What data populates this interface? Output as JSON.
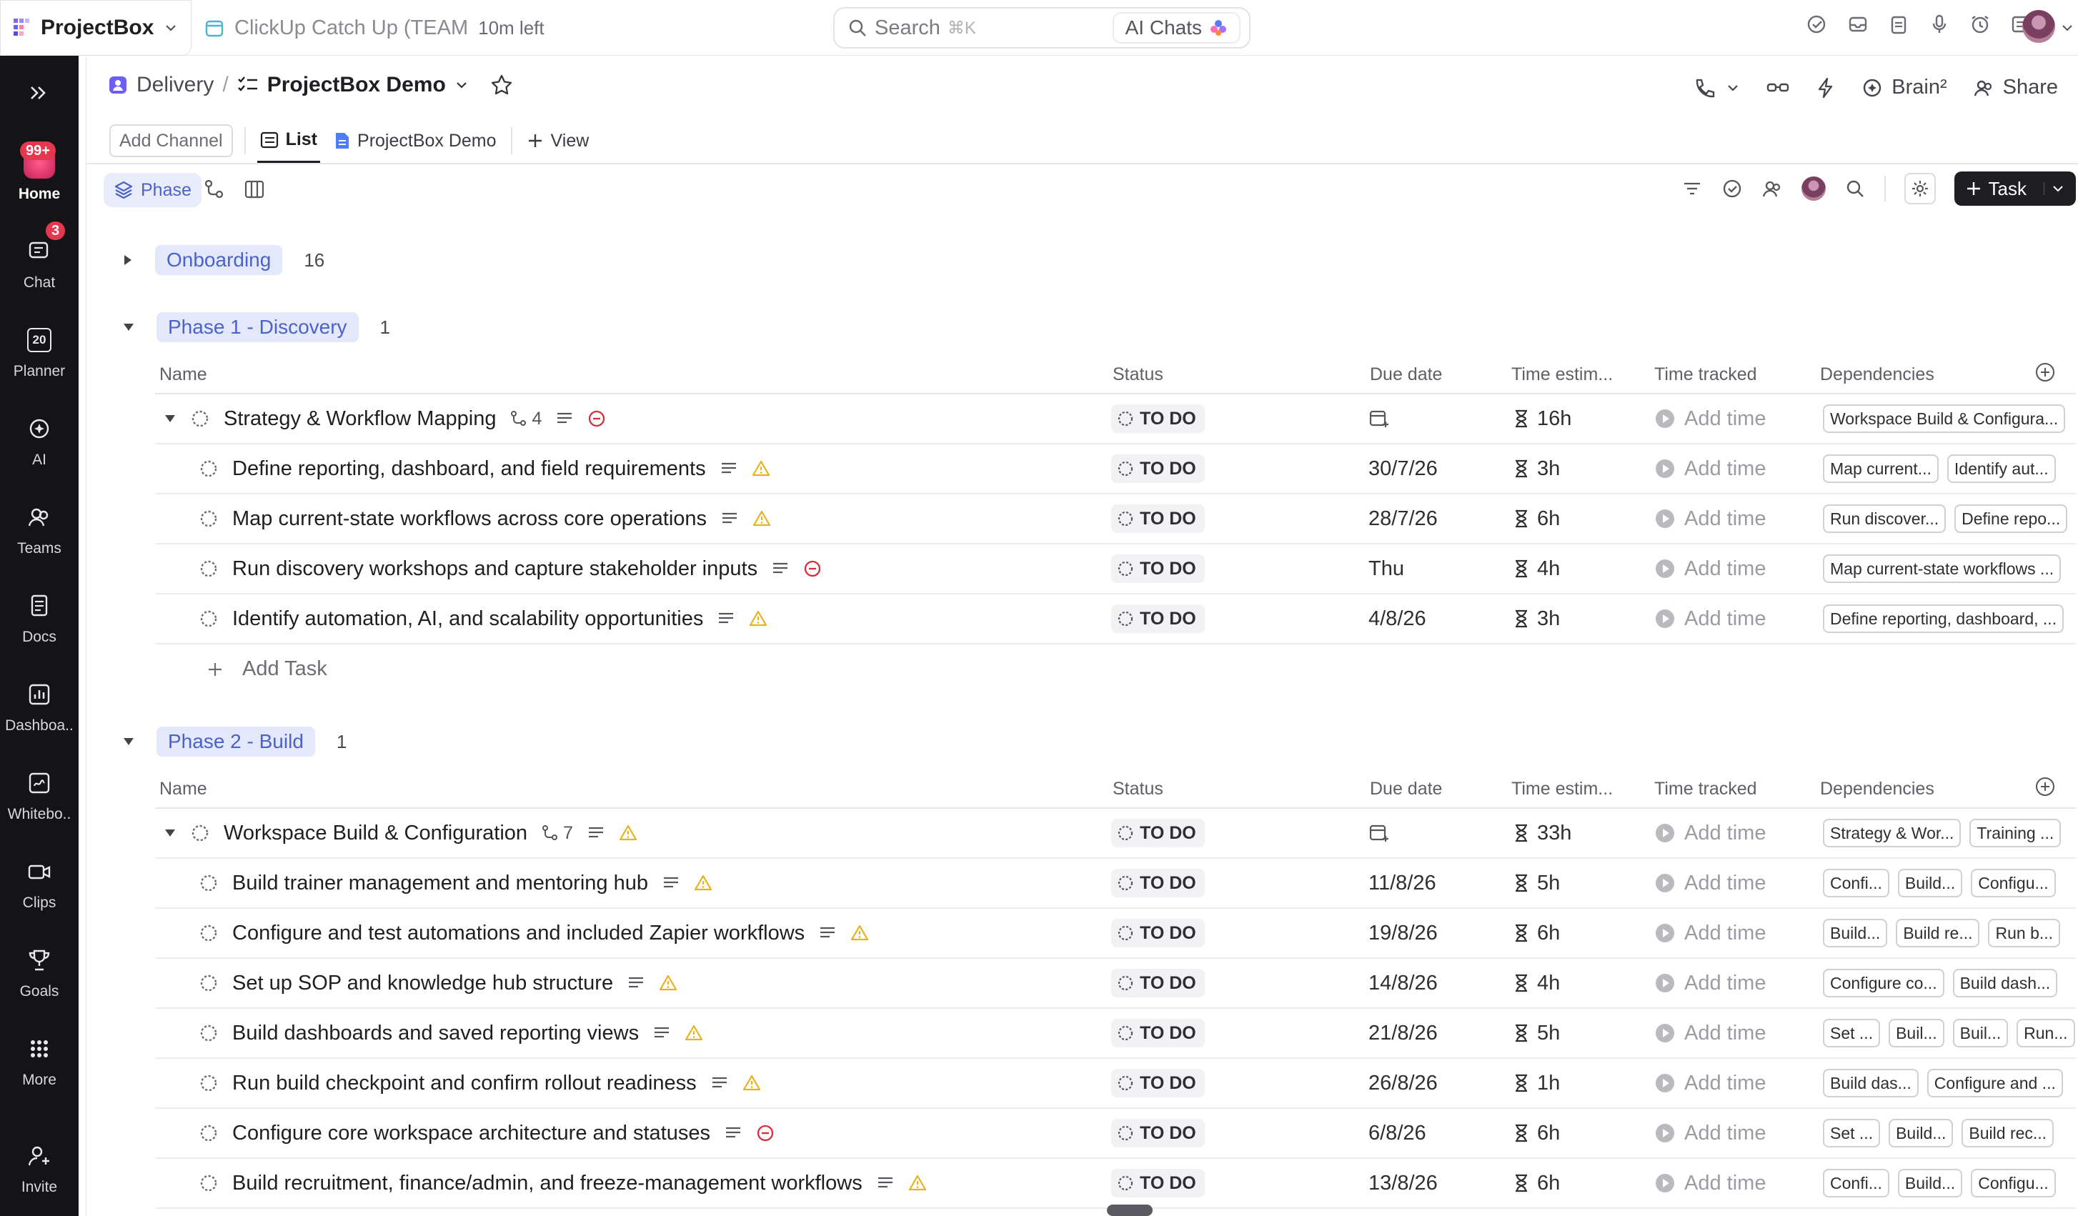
{
  "topbar": {
    "workspace": "ProjectBox",
    "reminder_title": "ClickUp Catch Up (TEAM",
    "reminder_time": "10m left",
    "search_placeholder": "Search",
    "search_shortcut": "⌘K",
    "ai_chats": "AI Chats"
  },
  "sidebar": {
    "items": [
      {
        "label": "Home",
        "badge": "99+"
      },
      {
        "label": "Chat",
        "badge": "3"
      },
      {
        "label": "Planner",
        "badge": "20"
      },
      {
        "label": "AI"
      },
      {
        "label": "Teams"
      },
      {
        "label": "Docs"
      },
      {
        "label": "Dashboa.."
      },
      {
        "label": "Whitebo.."
      },
      {
        "label": "Clips"
      },
      {
        "label": "Goals"
      },
      {
        "label": "More"
      },
      {
        "label": "Invite"
      }
    ]
  },
  "header": {
    "breadcrumb_space": "Delivery",
    "breadcrumb_sep": "/",
    "breadcrumb_list": "ProjectBox Demo",
    "brain": "Brain²",
    "share": "Share"
  },
  "tabs": {
    "add_channel": "Add Channel",
    "list": "List",
    "doc": "ProjectBox Demo",
    "view": "View"
  },
  "filters": {
    "group_by": "Phase",
    "task_button": "Task"
  },
  "columns": {
    "name": "Name",
    "status": "Status",
    "due": "Due date",
    "estimate": "Time estim...",
    "tracked": "Time tracked",
    "deps": "Dependencies"
  },
  "groups": [
    {
      "name": "Onboarding",
      "count": "16",
      "collapsed": true
    },
    {
      "name": "Phase 1 - Discovery",
      "count": "1",
      "parent": {
        "name": "Strategy & Workflow Mapping",
        "subtasks": "4",
        "status": "TO DO",
        "estimate": "16h",
        "tracked": "Add time",
        "deps": [
          "Workspace Build & Configura..."
        ]
      },
      "tasks": [
        {
          "name": "Define reporting, dashboard, and field requirements",
          "flag": "warning",
          "status": "TO DO",
          "due": "30/7/26",
          "estimate": "3h",
          "tracked": "Add time",
          "deps": [
            "Map current...",
            "Identify aut..."
          ]
        },
        {
          "name": "Map current-state workflows across core operations",
          "flag": "warning",
          "status": "TO DO",
          "due": "28/7/26",
          "estimate": "6h",
          "tracked": "Add time",
          "deps": [
            "Run discover...",
            "Define repo..."
          ]
        },
        {
          "name": "Run discovery workshops and capture stakeholder inputs",
          "flag": "blocked",
          "status": "TO DO",
          "due": "Thu",
          "estimate": "4h",
          "tracked": "Add time",
          "deps": [
            "Map current-state workflows ..."
          ]
        },
        {
          "name": "Identify automation, AI, and scalability opportunities",
          "flag": "warning",
          "status": "TO DO",
          "due": "4/8/26",
          "estimate": "3h",
          "tracked": "Add time",
          "deps": [
            "Define reporting, dashboard, ..."
          ]
        }
      ],
      "add_task": "Add Task"
    },
    {
      "name": "Phase 2 - Build",
      "count": "1",
      "parent": {
        "name": "Workspace Build & Configuration",
        "subtasks": "7",
        "status": "TO DO",
        "estimate": "33h",
        "tracked": "Add time",
        "deps": [
          "Strategy & Wor...",
          "Training ..."
        ]
      },
      "tasks": [
        {
          "name": "Build trainer management and mentoring hub",
          "flag": "warning",
          "status": "TO DO",
          "due": "11/8/26",
          "estimate": "5h",
          "tracked": "Add time",
          "deps": [
            "Confi...",
            "Build...",
            "Configu..."
          ]
        },
        {
          "name": "Configure and test automations and included Zapier workflows",
          "flag": "warning",
          "status": "TO DO",
          "due": "19/8/26",
          "estimate": "6h",
          "tracked": "Add time",
          "deps": [
            "Build...",
            "Build re...",
            "Run b..."
          ]
        },
        {
          "name": "Set up SOP and knowledge hub structure",
          "flag": "warning",
          "status": "TO DO",
          "due": "14/8/26",
          "estimate": "4h",
          "tracked": "Add time",
          "deps": [
            "Configure co...",
            "Build dash..."
          ]
        },
        {
          "name": "Build dashboards and saved reporting views",
          "flag": "warning",
          "status": "TO DO",
          "due": "21/8/26",
          "estimate": "5h",
          "tracked": "Add time",
          "deps": [
            "Set ...",
            "Buil...",
            "Buil...",
            "Run..."
          ]
        },
        {
          "name": "Run build checkpoint and confirm rollout readiness",
          "flag": "warning",
          "status": "TO DO",
          "due": "26/8/26",
          "estimate": "1h",
          "tracked": "Add time",
          "deps": [
            "Build das...",
            "Configure and ..."
          ]
        },
        {
          "name": "Configure core workspace architecture and statuses",
          "flag": "blocked",
          "status": "TO DO",
          "due": "6/8/26",
          "estimate": "6h",
          "tracked": "Add time",
          "deps": [
            "Set ...",
            "Build...",
            "Build rec..."
          ]
        },
        {
          "name": "Build recruitment, finance/admin, and freeze-management workflows",
          "flag": "warning",
          "status": "TO DO",
          "due": "13/8/26",
          "estimate": "6h",
          "tracked": "Add time",
          "deps": [
            "Confi...",
            "Build...",
            "Configu..."
          ]
        }
      ]
    }
  ],
  "colors": {
    "accent": "#4c62c9",
    "pill_bg": "#e3e9fb",
    "warning": "#e8b21c",
    "blocked": "#d92d3b",
    "rail_bg": "#141417"
  }
}
